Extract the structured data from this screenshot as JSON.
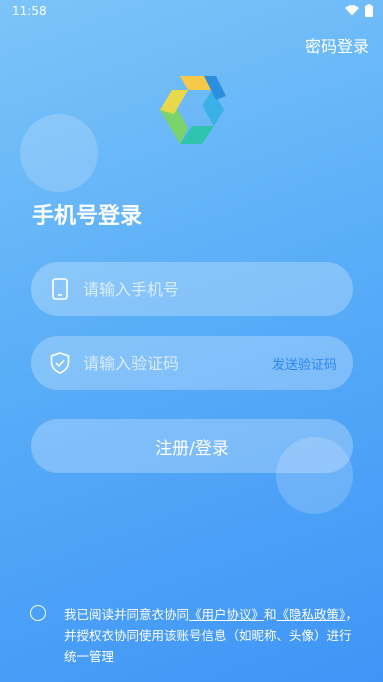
{
  "status": {
    "time": "11:58"
  },
  "header": {
    "password_login": "密码登录"
  },
  "page_title": "手机号登录",
  "phone": {
    "placeholder": "请输入手机号"
  },
  "code": {
    "placeholder": "请输入验证码",
    "send_label": "发送验证码"
  },
  "submit_label": "注册/登录",
  "agreement": {
    "prefix": "我已阅读并同意衣协同",
    "user_agreement": "《用户协议》",
    "and": "和",
    "privacy_policy": "《隐私政策》",
    "suffix": "，并授权衣协同使用该账号信息（如昵称、头像）进行统一管理"
  },
  "colors": {
    "accent": "#2f86e8",
    "bg_top": "#7cc4f8",
    "bg_bottom": "#3f95f6"
  },
  "icons": [
    "wifi-icon",
    "battery-icon",
    "app-logo",
    "phone-icon",
    "shield-check-icon",
    "radio-unchecked-icon"
  ]
}
